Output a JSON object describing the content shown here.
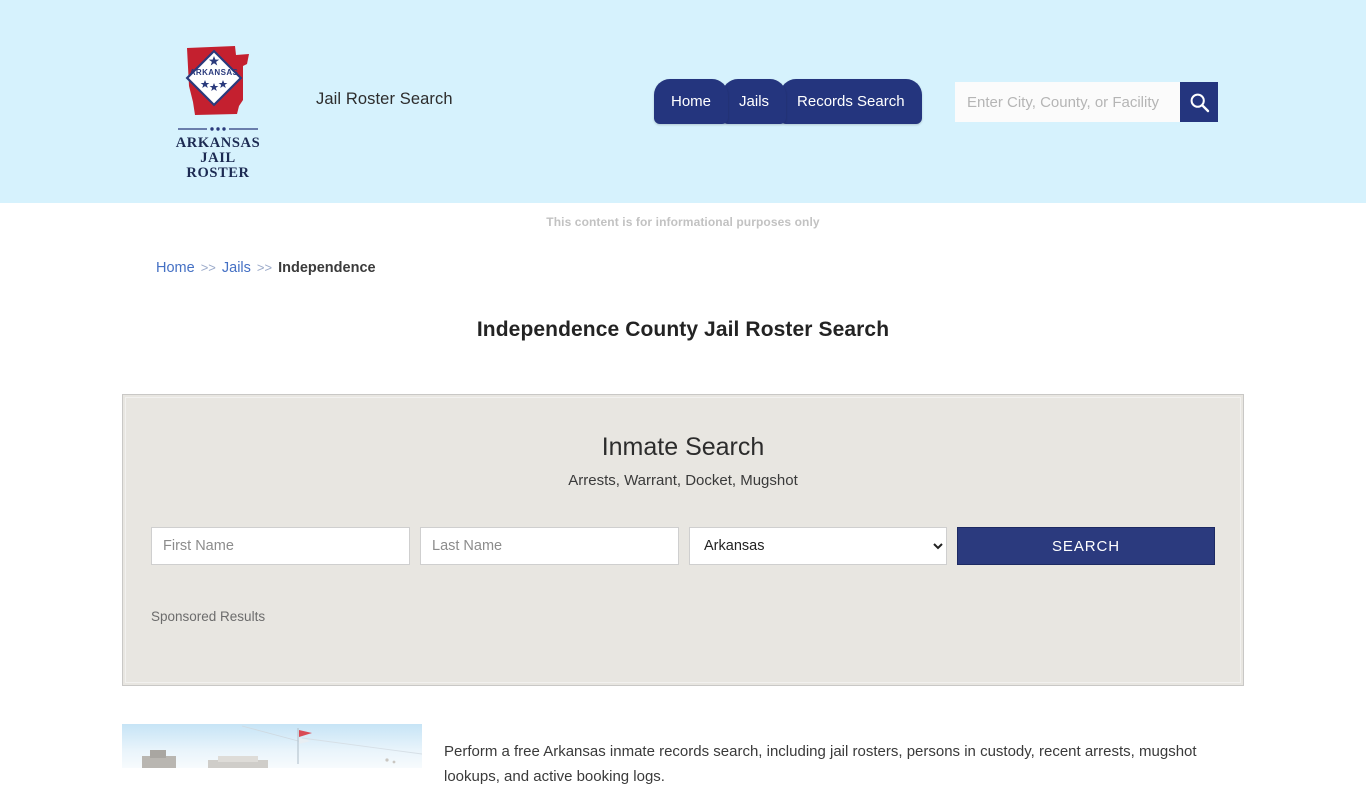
{
  "header": {
    "logo": {
      "name": "arkansas-jail-roster-logo",
      "diamond_text": "ARKANSAS",
      "wordmark_line1": "ARKANSAS",
      "wordmark_line2": "JAIL ROSTER",
      "state_color": "#c4202f",
      "diamond_border_color": "#2a3a7c"
    },
    "tagline": "Jail Roster Search",
    "nav": [
      {
        "label": "Home",
        "name": "nav-tab-home"
      },
      {
        "label": "Jails",
        "name": "nav-tab-jails"
      },
      {
        "label": "Records Search",
        "name": "nav-tab-records-search"
      }
    ],
    "search": {
      "placeholder": "Enter City, County, or Facility",
      "value": "",
      "button_icon": "search-icon"
    },
    "background_color": "#d6f2fd",
    "accent_color": "#24357e"
  },
  "notice": "This content is for informational purposes only",
  "breadcrumb": {
    "items": [
      {
        "label": "Home",
        "link": true
      },
      {
        "label": "Jails",
        "link": true
      },
      {
        "label": "Independence",
        "link": false
      }
    ],
    "separator": ">>"
  },
  "page_title": "Independence County Jail Roster Search",
  "search_card": {
    "title": "Inmate Search",
    "subtitle": "Arrests, Warrant, Docket, Mugshot",
    "first_name": {
      "placeholder": "First Name",
      "value": ""
    },
    "last_name": {
      "placeholder": "Last Name",
      "value": ""
    },
    "state": {
      "selected": "Arkansas",
      "options": [
        "Arkansas"
      ]
    },
    "search_button": "SEARCH",
    "sponsored_label": "Sponsored Results",
    "background_color": "#e8e6e1",
    "button_color": "#2b3a7e"
  },
  "content": {
    "image_alt": "county-courthouse-photo",
    "paragraph": "Perform a free Arkansas inmate records search, including jail rosters, persons in custody, recent arrests, mugshot lookups, and active booking logs."
  }
}
